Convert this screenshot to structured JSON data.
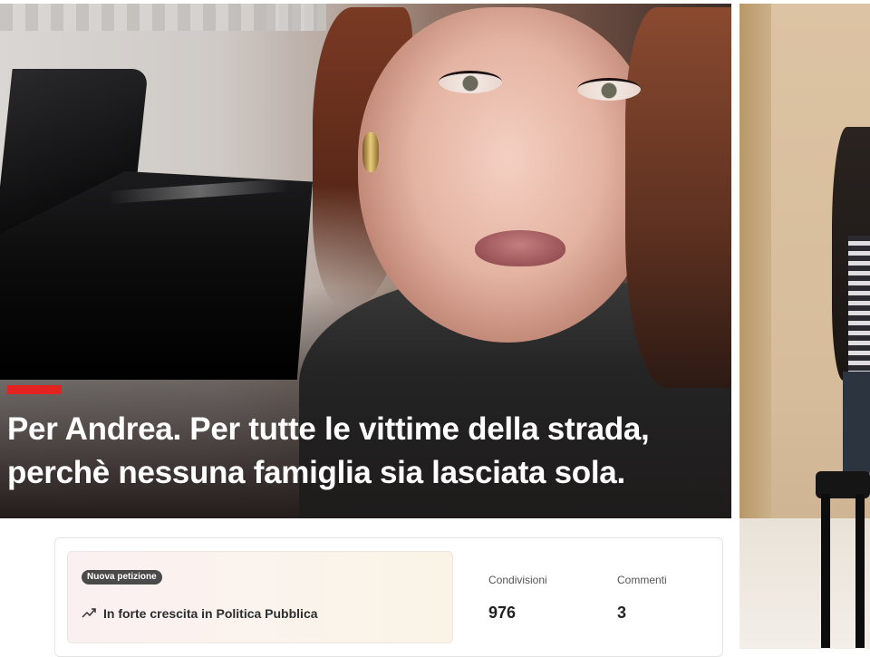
{
  "hero": {
    "headline_line1": "Per Andrea. Per tutte le vittime della strada,",
    "headline_line2": "perchè nessuna famiglia sia lasciata sola.",
    "accent_color": "#e3231f"
  },
  "petition": {
    "badge": "Nuova petizione",
    "trend_icon": "trending-up-icon",
    "trend_label": "In forte crescita in Politica Pubblica"
  },
  "stats": {
    "shares_label": "Condivisioni",
    "shares_value": "976",
    "comments_label": "Commenti",
    "comments_value": "3"
  }
}
